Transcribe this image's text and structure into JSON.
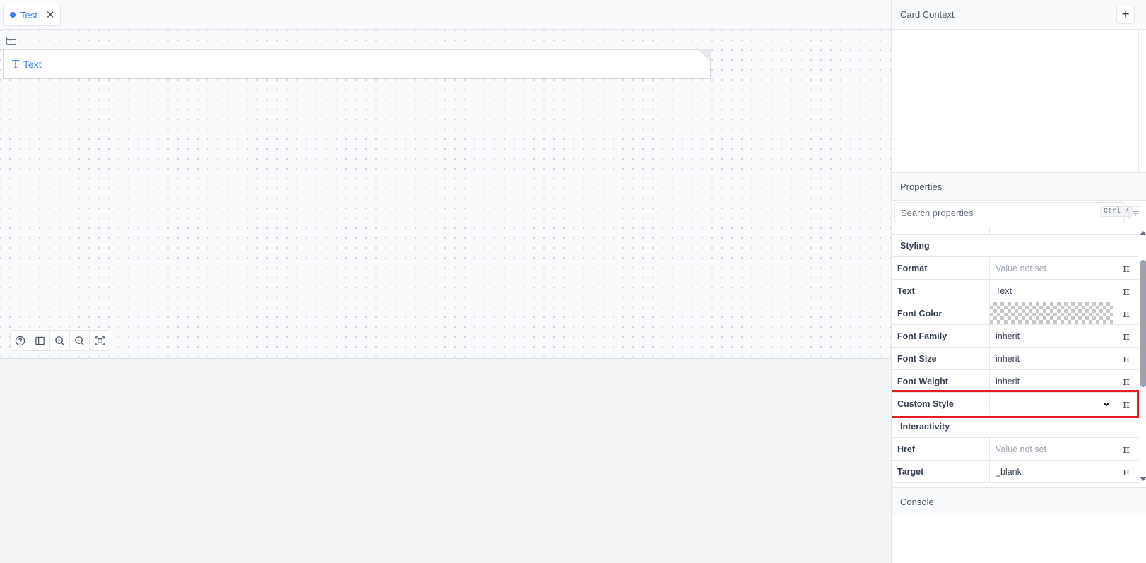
{
  "tab": {
    "label": "Test",
    "close_glyph": "✕"
  },
  "canvas": {
    "block_icon": "T",
    "block_label": "Text"
  },
  "toolbar": {
    "icons": [
      "help-icon",
      "sidebar-icon",
      "zoom-in-icon",
      "zoom-out-icon",
      "fit-screen-icon"
    ]
  },
  "card_context": {
    "title": "Card Context",
    "add_glyph": "+"
  },
  "properties": {
    "title": "Properties",
    "search_placeholder": "Search properties",
    "shortcut": "Ctrl /",
    "pi_glyph": "π",
    "sections": {
      "styling": "Styling",
      "interactivity": "Interactivity"
    },
    "rows": {
      "format": {
        "label": "Format",
        "value": "Value not set"
      },
      "text": {
        "label": "Text",
        "value": "Text"
      },
      "font_color": {
        "label": "Font Color",
        "value": ""
      },
      "font_family": {
        "label": "Font Family",
        "value": "inherit"
      },
      "font_size": {
        "label": "Font Size",
        "value": "inherit"
      },
      "font_weight": {
        "label": "Font Weight",
        "value": "inherit"
      },
      "custom_style": {
        "label": "Custom Style",
        "value": ""
      },
      "href": {
        "label": "Href",
        "value": "Value not set"
      },
      "target": {
        "label": "Target",
        "value": "_blank"
      }
    },
    "highlight_color": "#e11d26"
  },
  "console": {
    "title": "Console"
  }
}
